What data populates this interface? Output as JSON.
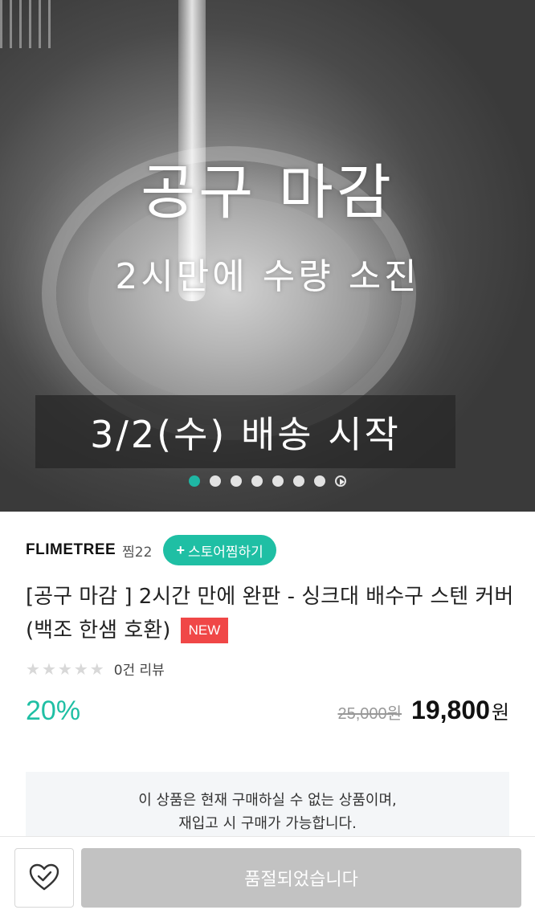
{
  "hero": {
    "title_line1": "공구 마감",
    "title_line2": "2시만에 수량 소진",
    "ship_text": "3/2(수) 배송 시작",
    "slide_count": 7,
    "active_slide": 1,
    "accent_color": "#1fbfa4"
  },
  "store": {
    "name": "FLIMETREE",
    "like_text": "찜22",
    "follow_label": "스토어찜하기",
    "follow_icon": "plus-icon"
  },
  "product": {
    "title": "[공구 마감 ] 2시간 만에 완판 - 싱크대 배수구 스텐 커버 (백조 한샘 호환)",
    "badge": "NEW",
    "badge_color": "#f04747"
  },
  "rating": {
    "stars_filled": 0,
    "stars_total": 5,
    "review_text": "0건 리뷰"
  },
  "price": {
    "discount": "20%",
    "original": "25,000원",
    "sale": "19,800",
    "currency": "원"
  },
  "notice": {
    "line1": "이 상품은 현재 구매하실 수 없는 상품이며,",
    "line2": "재입고 시 구매가 가능합니다."
  },
  "bottom_bar": {
    "wishlist_icon": "heart-check-icon",
    "soldout_label": "품절되었습니다"
  }
}
